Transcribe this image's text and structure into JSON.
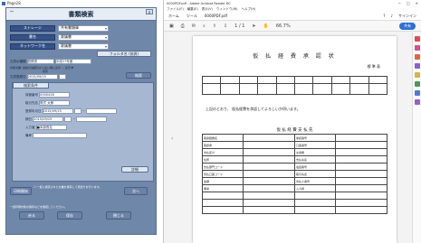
{
  "app": {
    "window_title": "Page28",
    "panel_title": "書類検索",
    "stars": "** ",
    "fields": [
      {
        "label": "ストレージ",
        "value": "共有書類庫"
      },
      {
        "label": "書名",
        "value": "稟議書"
      },
      {
        "label": "ネットワーク名",
        "value": "稟議書"
      }
    ],
    "folder_button": "フォルダ名 (前頁)",
    "status_label": "文書の種類",
    "status_value": "見積書",
    "status_value2": "平成27年度",
    "note_line": "対象文書: 最新の決裁日から古い順に表示 ... 表示 ▼",
    "sub_note": "検索",
    "date_label": "文書登録日",
    "date_value": "2015/09/15",
    "go_button": "検索",
    "sub_tab": "検索条件",
    "rows": [
      {
        "label": "保管番号",
        "value": "0000418"
      },
      {
        "label": "取引先名",
        "value": "株式 太郎"
      },
      {
        "label": "登録年月日",
        "value": "2015/09/25"
      },
      {
        "label": "期日",
        "value": "2015/09/25"
      },
      {
        "label": "入力者",
        "value": "■本部長名"
      },
      {
        "label": "備考",
        "value": ""
      }
    ],
    "small_btn": "詳細",
    "print_btn": "印刷開始",
    "checkbox_text": "一度に検索された文書を保存して頁送りを行います。",
    "next_btn": "次へ",
    "bottom_text": "一括印刷対象の保存などを確認してください。",
    "bottom_buttons": [
      "戻る",
      "保存",
      "閉じる"
    ],
    "dropdown_icon": "▾"
  },
  "viewer": {
    "window_title": "0000PDF.pdf - Adobe Acrobat Reader DC",
    "menu": [
      "ファイル(F)",
      "編集(E)",
      "表示(V)",
      "ウィンドウ(W)",
      "ヘルプ(H)"
    ],
    "tabs": [
      "ホーム",
      "ツール"
    ],
    "tab_active": "0000PDF.pdf",
    "signin": "サインイン",
    "share": "共有",
    "zoom": "66.7%",
    "page_num": "1 / 1",
    "doc_title": "仮 払 経 費 承 認 状",
    "doc_subtitle": "標 準 表",
    "doc_body": "上記のとおり、 仮払経費を承認してよろしいか伺います。",
    "table_title": "仮 払 経 費 支 払 先",
    "cells": [
      "取扱経費名",
      "承認番号",
      "取扱者",
      "口座番号",
      "支払区分",
      "交通費",
      "住所",
      "支払先名",
      "支払部門コード",
      "電話番号",
      "支払口座コード",
      "取引先名",
      "金額",
      "支払人番号",
      "備考",
      "入力者"
    ]
  }
}
